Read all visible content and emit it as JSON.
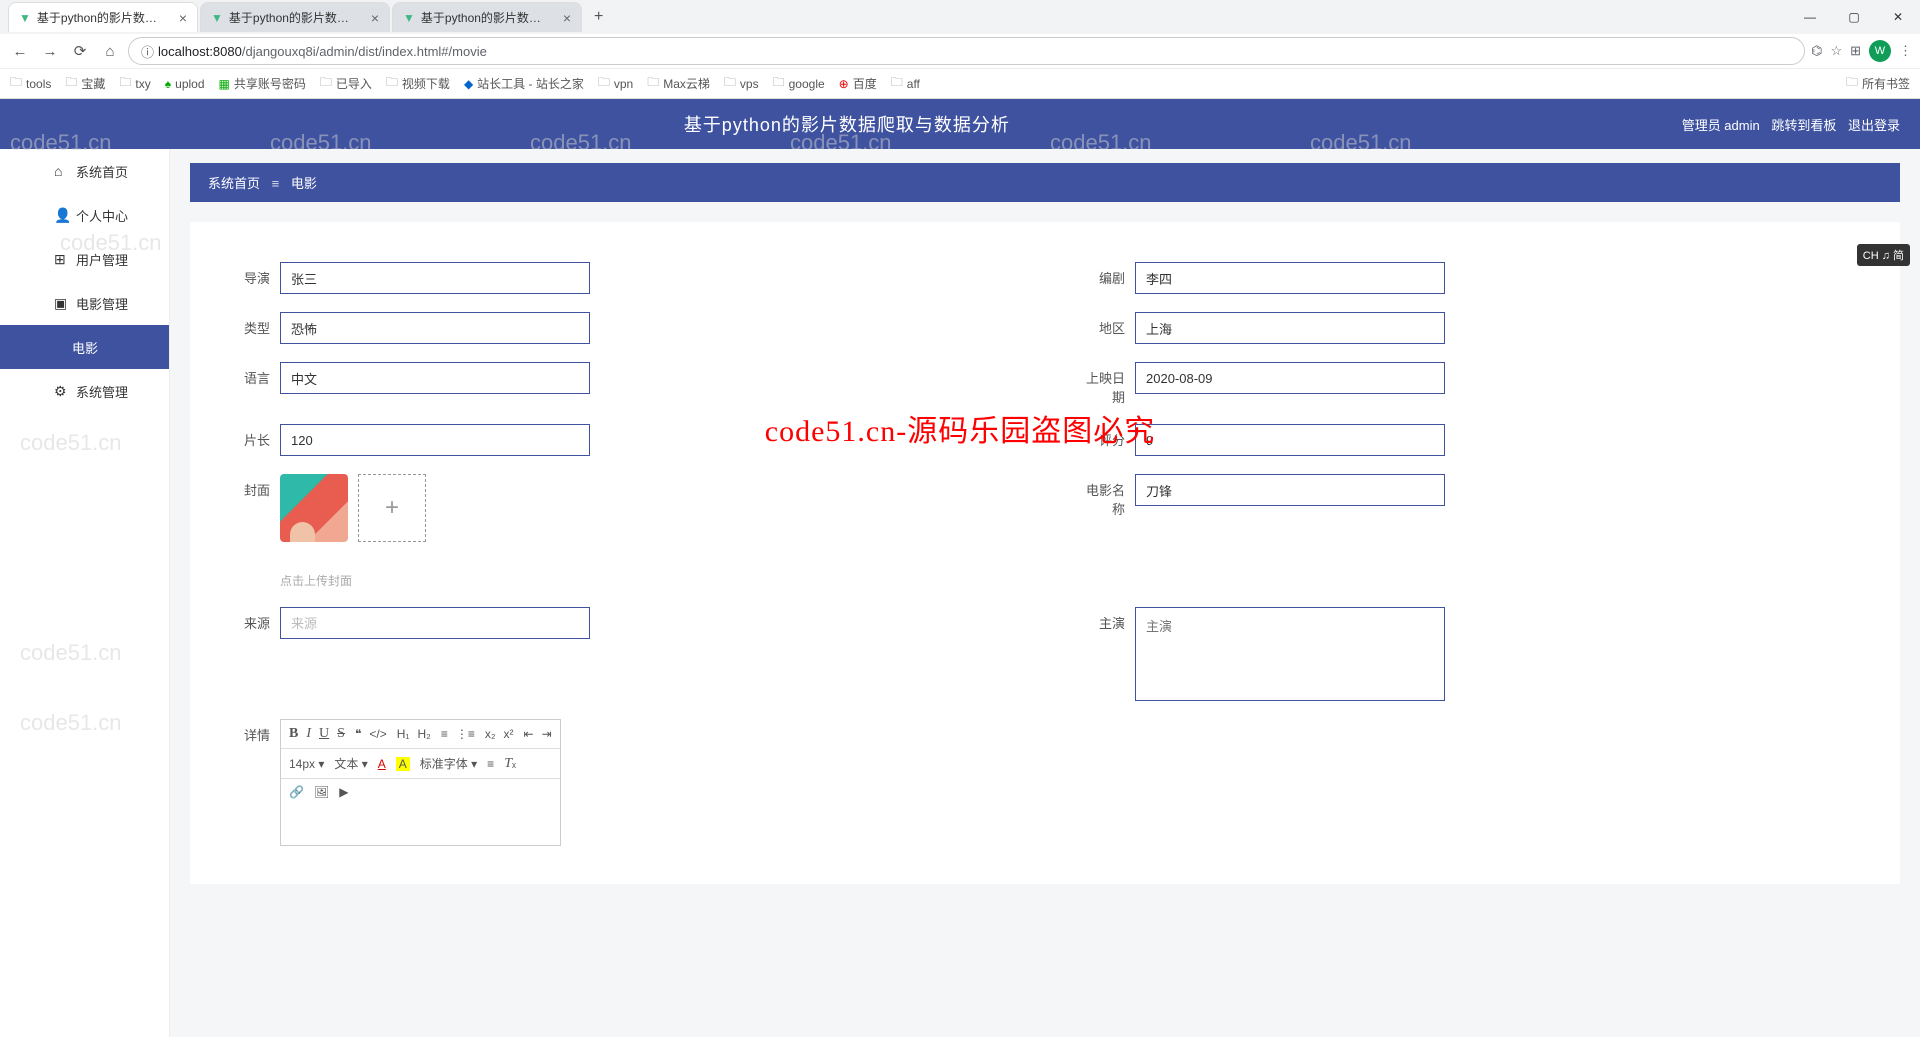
{
  "browser": {
    "tabs": [
      {
        "title": "基于python的影片数据爬取与",
        "active": true
      },
      {
        "title": "基于python的影片数据爬取与",
        "active": false
      },
      {
        "title": "基于python的影片数据爬取与",
        "active": false
      }
    ],
    "url_prefix": "localhost:8080",
    "url_path": "/djangouxq8i/admin/dist/index.html#/movie",
    "bookmarks": [
      "tools",
      "宝藏",
      "txy",
      "uplod",
      "共享账号密码",
      "已导入",
      "视频下载",
      "站长工具 - 站长之家",
      "vpn",
      "Max云梯",
      "vps",
      "google",
      "百度",
      "aff"
    ],
    "all_bookmarks": "所有书签",
    "avatar": "W"
  },
  "header": {
    "title": "基于python的影片数据爬取与数据分析",
    "admin_label": "管理员 admin",
    "jump": "跳转到看板",
    "logout": "退出登录"
  },
  "sidebar": {
    "home": "系统首页",
    "personal": "个人中心",
    "user_mgmt": "用户管理",
    "movie_mgmt": "电影管理",
    "movie": "电影",
    "sys_mgmt": "系统管理"
  },
  "breadcrumb": {
    "home": "系统首页",
    "current": "电影"
  },
  "form": {
    "labels": {
      "director": "导演",
      "writer": "编剧",
      "type": "类型",
      "region": "地区",
      "language": "语言",
      "release": "上映日期",
      "duration": "片长",
      "score": "评分",
      "cover": "封面",
      "movie_name": "电影名称",
      "source": "来源",
      "actors": "主演",
      "detail": "详情"
    },
    "values": {
      "director": "张三",
      "writer": "李四",
      "type": "恐怖",
      "region": "上海",
      "language": "中文",
      "release": "2020-08-09",
      "duration": "120",
      "score": "9",
      "movie_name": "刀锋",
      "source": "",
      "actors": ""
    },
    "placeholders": {
      "source": "来源",
      "actors": "主演"
    },
    "upload_hint": "点击上传封面"
  },
  "editor": {
    "font_size": "14px",
    "font_type": "文本",
    "font_family": "标准字体"
  },
  "ime": "CH ♫ 简",
  "watermark": {
    "text": "code51.cn",
    "red": "code51.cn-源码乐园盗图必究"
  }
}
